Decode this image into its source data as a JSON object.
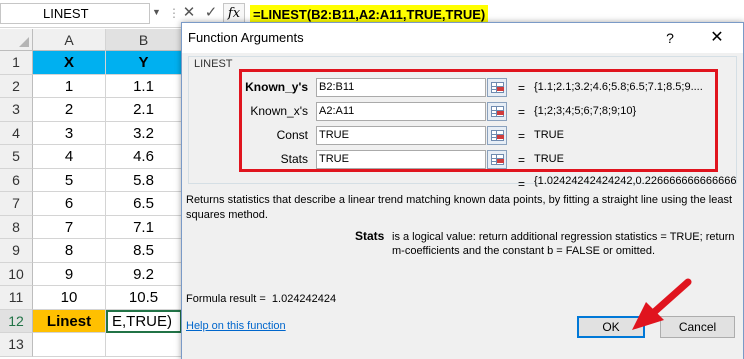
{
  "formula_bar": {
    "name_box": "LINEST",
    "separator": "⋮",
    "cancel_icon": "✕",
    "enter_icon": "✓",
    "fx_label": "fx",
    "formula": "=LINEST(B2:B11,A2:A11,TRUE,TRUE)"
  },
  "sheet": {
    "columns": [
      "A",
      "B"
    ],
    "rows": [
      {
        "num": "1",
        "a": "X",
        "b": "Y"
      },
      {
        "num": "2",
        "a": "1",
        "b": "1.1"
      },
      {
        "num": "3",
        "a": "2",
        "b": "2.1"
      },
      {
        "num": "4",
        "a": "3",
        "b": "3.2"
      },
      {
        "num": "5",
        "a": "4",
        "b": "4.6"
      },
      {
        "num": "6",
        "a": "5",
        "b": "5.8"
      },
      {
        "num": "7",
        "a": "6",
        "b": "6.5"
      },
      {
        "num": "8",
        "a": "7",
        "b": "7.1"
      },
      {
        "num": "9",
        "a": "8",
        "b": "8.5"
      },
      {
        "num": "10",
        "a": "9",
        "b": "9.2"
      },
      {
        "num": "11",
        "a": "10",
        "b": "10.5"
      },
      {
        "num": "12",
        "a": "Linest",
        "b": "E,TRUE)"
      },
      {
        "num": "13",
        "a": "",
        "b": ""
      }
    ],
    "colors": {
      "header_fill": "#00b0f0",
      "linest_fill": "#ffc000",
      "formula_highlight": "#ffff00"
    }
  },
  "dialog": {
    "title": "Function Arguments",
    "help_button": "?",
    "close_button": "✕",
    "group_label": "LINEST",
    "args": [
      {
        "label": "Known_y's",
        "value": "B2:B11",
        "result": "{1.1;2.1;3.2;4.6;5.8;6.5;7.1;8.5;9...."
      },
      {
        "label": "Known_x's",
        "value": "A2:A11",
        "result": "{1;2;3;4;5;6;7;8;9;10}"
      },
      {
        "label": "Const",
        "value": "TRUE",
        "result": "TRUE"
      },
      {
        "label": "Stats",
        "value": "TRUE",
        "result": "TRUE"
      }
    ],
    "equals": "=",
    "overall_result": "{1.02424242424242,0.226666666666666",
    "description": "Returns statistics that describe a linear trend matching known data points, by fitting a straight line using the least squares method.",
    "stats_name": "Stats",
    "stats_description": "is a logical value: return additional regression statistics = TRUE; return m-coefficients and the constant b = FALSE or omitted.",
    "formula_result_label": "Formula result =",
    "formula_result_value": "1.024242424",
    "help_link": "Help on this function",
    "ok_button": "OK",
    "cancel_button": "Cancel",
    "annotation_color": "#e0141e"
  }
}
